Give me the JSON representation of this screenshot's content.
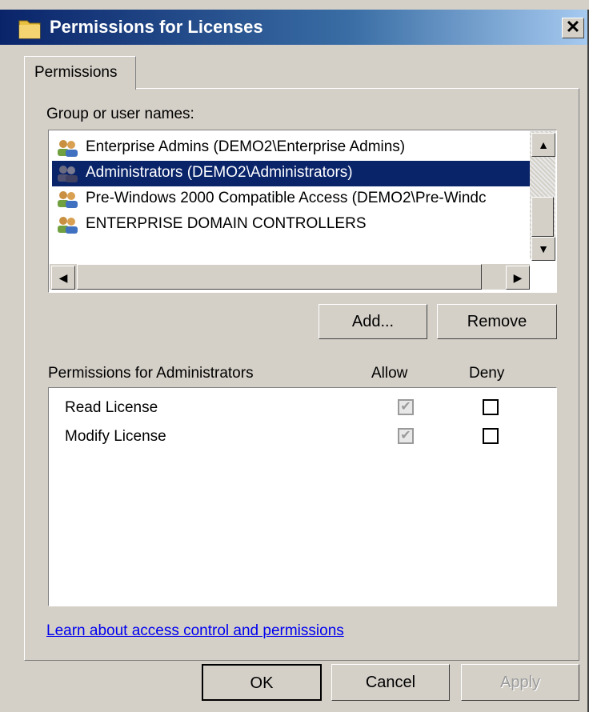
{
  "window": {
    "title": "Permissions for Licenses"
  },
  "tabs": [
    {
      "label": "Permissions",
      "selected": true
    }
  ],
  "groups": {
    "label": "Group or user names:",
    "items": [
      {
        "label": "Enterprise Admins (DEMO2\\Enterprise Admins)",
        "selected": false,
        "icon": "users-group-icon"
      },
      {
        "label": "Administrators (DEMO2\\Administrators)",
        "selected": true,
        "icon": "users-group-icon"
      },
      {
        "label": "Pre-Windows 2000 Compatible Access (DEMO2\\Pre-Windc",
        "selected": false,
        "icon": "users-group-icon"
      },
      {
        "label": "ENTERPRISE DOMAIN CONTROLLERS",
        "selected": false,
        "icon": "users-group-icon"
      }
    ],
    "add_label": "Add...",
    "remove_label": "Remove"
  },
  "permissions": {
    "header": "Permissions for Administrators",
    "allow_header": "Allow",
    "deny_header": "Deny",
    "rows": [
      {
        "name": "Read License",
        "allow": true,
        "allow_enabled": false,
        "deny": false
      },
      {
        "name": "Modify License",
        "allow": true,
        "allow_enabled": false,
        "deny": false
      }
    ]
  },
  "link": "Learn about access control and permissions",
  "footer": {
    "ok": "OK",
    "cancel": "Cancel",
    "apply": "Apply",
    "apply_enabled": false
  },
  "colors": {
    "selection": "#0a246a",
    "face": "#d4d0c8",
    "title_gradient_start": "#0a246a"
  }
}
